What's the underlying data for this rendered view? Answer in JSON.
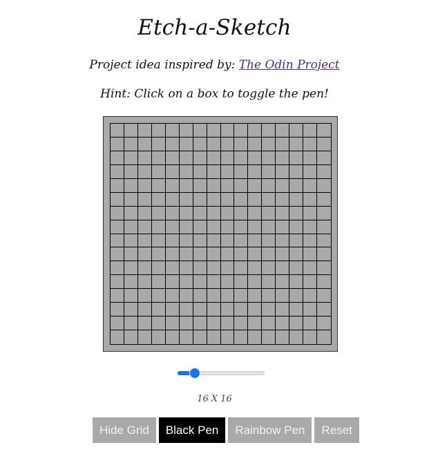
{
  "header": {
    "title": "Etch-a-Sketch",
    "subtitle_prefix": "Project idea inspired by:",
    "subtitle_link": "The Odin Project",
    "hint": "Hint: Click on a box to toggle the pen!"
  },
  "grid": {
    "rows": 16,
    "cols": 16,
    "cell_color": "#a9a9a9",
    "border_color": "#000000",
    "board_color": "#a9a9a9"
  },
  "controls": {
    "slider_value": 16,
    "slider_min": 1,
    "slider_max": 100,
    "size_label": "16 X 16",
    "buttons": [
      {
        "label": "Hide Grid",
        "active": false
      },
      {
        "label": "Black Pen",
        "active": true
      },
      {
        "label": "Rainbow Pen",
        "active": false
      },
      {
        "label": "Reset",
        "active": false
      }
    ]
  },
  "colors": {
    "accent": "#1a73e8",
    "button_gray": "#a9a9a9",
    "button_active": "#000000"
  }
}
